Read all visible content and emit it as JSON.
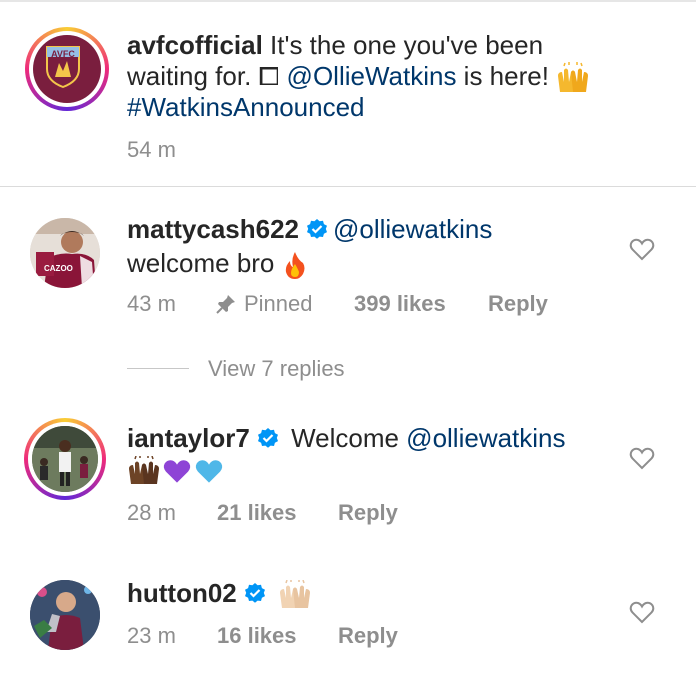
{
  "caption": {
    "username": "avfcofficial",
    "text_part1": " It's the one you've been",
    "text_part2": "waiting for. ⧠ ",
    "mention": "@OllieWatkins",
    "text_part3": " is here! ",
    "hashtag": "#WatkinsAnnounced",
    "time": "54 m",
    "badge_text": "AVFC"
  },
  "comments": [
    {
      "username": "mattycash622",
      "mention": "@olliewatkins",
      "text": "welcome bro",
      "time": "43 m",
      "pinned_label": "Pinned",
      "likes": "399 likes",
      "reply": "Reply",
      "shirt_text": "CAZOO"
    },
    {
      "username": "iantaylor7",
      "text": "Welcome ",
      "mention": "@olliewatkins",
      "time": "28 m",
      "likes": "21 likes",
      "reply": "Reply"
    },
    {
      "username": "hutton02",
      "time": "23 m",
      "likes": "16 likes",
      "reply": "Reply"
    }
  ],
  "view_replies": "View 7 replies",
  "colors": {
    "text": "#262626",
    "secondary": "#8e8e8e",
    "link": "#00376b",
    "verified": "#0095f6",
    "club_claret": "#7a1e3e"
  }
}
